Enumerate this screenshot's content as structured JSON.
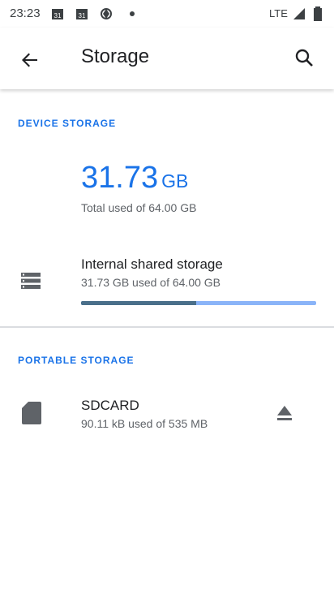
{
  "status_bar": {
    "time": "23:23",
    "network": "LTE",
    "icons": [
      "calendar-icon",
      "calendar-icon",
      "location-icon",
      "dot-icon",
      "signal-icon",
      "battery-icon"
    ]
  },
  "app_bar": {
    "title": "Storage",
    "back_icon": "arrow-back-icon",
    "search_icon": "search-icon"
  },
  "device_storage": {
    "header": "DEVICE STORAGE",
    "used_value": "31.73",
    "used_unit": "GB",
    "total_label": "Total used of 64.00 GB",
    "internal": {
      "icon": "storage-icon",
      "title": "Internal shared storage",
      "subtitle": "31.73 GB used of 64.00 GB",
      "usage_fraction": 0.49
    }
  },
  "portable_storage": {
    "header": "PORTABLE STORAGE",
    "sdcard": {
      "icon": "sd-card-icon",
      "title": "SDCARD",
      "subtitle": "90.11 kB used of 535 MB",
      "action_icon": "eject-icon"
    }
  },
  "colors": {
    "accent": "#1a73e8",
    "bar_fill": "#4a6f8a",
    "bar_track": "#8ab4f8"
  }
}
